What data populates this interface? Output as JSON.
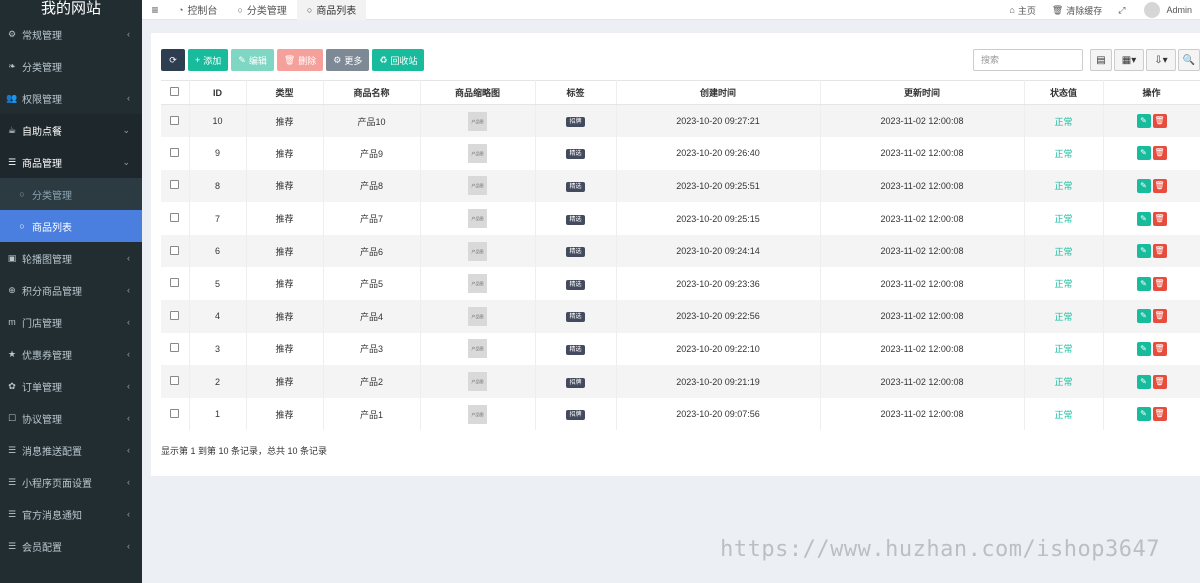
{
  "sidebar": {
    "brand": "我的网站",
    "items": [
      {
        "icon": "⚙",
        "label": "常规管理",
        "chevron": "‹",
        "type": "top"
      },
      {
        "icon": "❧",
        "label": "分类管理",
        "chevron": "",
        "type": "top"
      },
      {
        "icon": "👥",
        "label": "权限管理",
        "chevron": "‹",
        "type": "top"
      },
      {
        "icon": "☕",
        "label": "自助点餐",
        "chevron": "⌄",
        "type": "open"
      },
      {
        "icon": "☰",
        "label": "商品管理",
        "chevron": "⌄",
        "type": "group"
      },
      {
        "icon": "○",
        "label": "分类管理",
        "chevron": "",
        "type": "sub"
      },
      {
        "icon": "○",
        "label": "商品列表",
        "chevron": "",
        "type": "sub-active"
      },
      {
        "icon": "▣",
        "label": "轮播图管理",
        "chevron": "‹",
        "type": "top"
      },
      {
        "icon": "⊕",
        "label": "积分商品管理",
        "chevron": "‹",
        "type": "top"
      },
      {
        "icon": "m",
        "label": "门店管理",
        "chevron": "‹",
        "type": "top"
      },
      {
        "icon": "★",
        "label": "优惠券管理",
        "chevron": "‹",
        "type": "top"
      },
      {
        "icon": "✿",
        "label": "订单管理",
        "chevron": "‹",
        "type": "top"
      },
      {
        "icon": "☐",
        "label": "协议管理",
        "chevron": "‹",
        "type": "top"
      },
      {
        "icon": "☰",
        "label": "消息推送配置",
        "chevron": "‹",
        "type": "top"
      },
      {
        "icon": "☰",
        "label": "小程序页面设置",
        "chevron": "‹",
        "type": "top"
      },
      {
        "icon": "☰",
        "label": "官方消息通知",
        "chevron": "‹",
        "type": "top"
      },
      {
        "icon": "☰",
        "label": "会员配置",
        "chevron": "‹",
        "type": "top"
      }
    ]
  },
  "topbar": {
    "menu_icon": "≡",
    "tabs": [
      {
        "icon": "◔",
        "label": "控制台"
      },
      {
        "icon": "○",
        "label": "分类管理"
      },
      {
        "icon": "○",
        "label": "商品列表"
      }
    ],
    "right": [
      {
        "icon": "⌂",
        "label": "主页"
      },
      {
        "icon": "🗑",
        "label": "清除缓存"
      },
      {
        "icon": "⤢",
        "label": ""
      }
    ],
    "user": "Admin"
  },
  "toolbar": {
    "refresh_icon": "⟳",
    "add": {
      "icon": "+",
      "label": "添加"
    },
    "edit": {
      "icon": "✎",
      "label": "编辑"
    },
    "delete": {
      "icon": "🗑",
      "label": "删除"
    },
    "more": {
      "icon": "⚙",
      "label": "更多"
    },
    "recycle": {
      "icon": "♻",
      "label": "回收站"
    },
    "search_placeholder": "搜索",
    "right_buttons": [
      "▤",
      "▦▾",
      "⇩▾",
      "🔍"
    ]
  },
  "table": {
    "columns": [
      "",
      "ID",
      "类型",
      "商品名称",
      "商品缩略图",
      "标签",
      "创建时间",
      "更新时间",
      "状态值",
      "操作"
    ],
    "thumb_text": "产品图",
    "rows": [
      {
        "id": "10",
        "type": "推荐",
        "name": "产品10",
        "tag": "招牌",
        "created": "2023-10-20 09:27:21",
        "updated": "2023-11-02 12:00:08",
        "status": "正常"
      },
      {
        "id": "9",
        "type": "推荐",
        "name": "产品9",
        "tag": "精选",
        "created": "2023-10-20 09:26:40",
        "updated": "2023-11-02 12:00:08",
        "status": "正常"
      },
      {
        "id": "8",
        "type": "推荐",
        "name": "产品8",
        "tag": "精选",
        "created": "2023-10-20 09:25:51",
        "updated": "2023-11-02 12:00:08",
        "status": "正常"
      },
      {
        "id": "7",
        "type": "推荐",
        "name": "产品7",
        "tag": "精选",
        "created": "2023-10-20 09:25:15",
        "updated": "2023-11-02 12:00:08",
        "status": "正常"
      },
      {
        "id": "6",
        "type": "推荐",
        "name": "产品6",
        "tag": "精选",
        "created": "2023-10-20 09:24:14",
        "updated": "2023-11-02 12:00:08",
        "status": "正常"
      },
      {
        "id": "5",
        "type": "推荐",
        "name": "产品5",
        "tag": "精选",
        "created": "2023-10-20 09:23:36",
        "updated": "2023-11-02 12:00:08",
        "status": "正常"
      },
      {
        "id": "4",
        "type": "推荐",
        "name": "产品4",
        "tag": "精选",
        "created": "2023-10-20 09:22:56",
        "updated": "2023-11-02 12:00:08",
        "status": "正常"
      },
      {
        "id": "3",
        "type": "推荐",
        "name": "产品3",
        "tag": "精选",
        "created": "2023-10-20 09:22:10",
        "updated": "2023-11-02 12:00:08",
        "status": "正常"
      },
      {
        "id": "2",
        "type": "推荐",
        "name": "产品2",
        "tag": "招牌",
        "created": "2023-10-20 09:21:19",
        "updated": "2023-11-02 12:00:08",
        "status": "正常"
      },
      {
        "id": "1",
        "type": "推荐",
        "name": "产品1",
        "tag": "招牌",
        "created": "2023-10-20 09:07:56",
        "updated": "2023-11-02 12:00:08",
        "status": "正常"
      }
    ],
    "op_edit_icon": "✎",
    "op_delete_icon": "🗑"
  },
  "footer": {
    "summary": "显示第 1 到第 10 条记录，总共 10 条记录"
  },
  "watermark": "https://www.huzhan.com/ishop3647",
  "colors": {
    "sidebar_bg": "#222d32",
    "active_item": "#4a7fe0",
    "accent_green": "#18bc9c",
    "danger_red": "#e74c3c"
  }
}
